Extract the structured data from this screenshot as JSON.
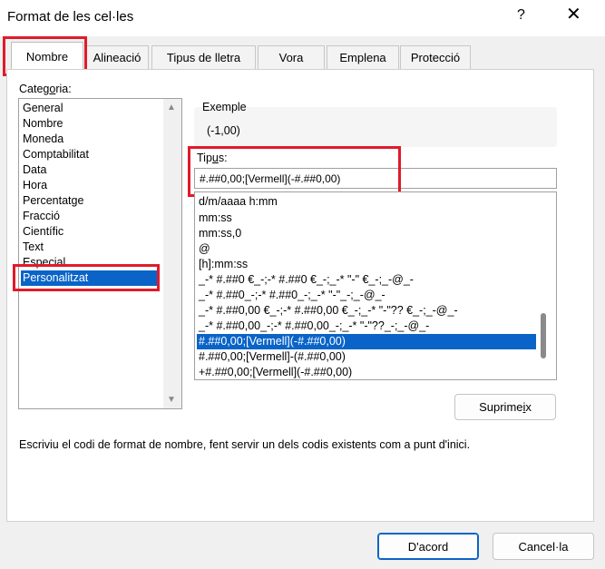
{
  "window": {
    "title": "Format de les cel·les",
    "help": "?",
    "close": "✕"
  },
  "tabs": [
    "Nombre",
    "Alineació",
    "Tipus de lletra",
    "Vora",
    "Emplena",
    "Protecció"
  ],
  "category": {
    "label_pre": "Categ",
    "label_u": "o",
    "label_post": "ria:",
    "items": [
      "General",
      "Nombre",
      "Moneda",
      "Comptabilitat",
      "Data",
      "Hora",
      "Percentatge",
      "Fracció",
      "Científic",
      "Text",
      "Especial",
      "Personalitzat"
    ],
    "selected": "Personalitzat"
  },
  "example": {
    "label": "Exemple",
    "value": "(-1,00)"
  },
  "type": {
    "label_pre": "Tip",
    "label_u": "u",
    "label_post": "s:",
    "value": "#.##0,00;[Vermell](-#.##0,00)",
    "items": [
      "d/m/aaaa h:mm",
      "mm:ss",
      "mm:ss,0",
      "@",
      "[h]:mm:ss",
      "_-* #.##0 €_-;-* #.##0 €_-;_-* \"-\" €_-;_-@_-",
      "_-* #.##0_-;-* #.##0_-;_-* \"-\"_-;_-@_-",
      "_-* #.##0,00 €_-;-* #.##0,00 €_-;_-* \"-\"?? €_-;_-@_-",
      "_-* #.##0,00_-;-* #.##0,00_-;_-* \"-\"??_-;_-@_-",
      "#.##0,00;[Vermell](-#.##0,00)",
      "#.##0,00;[Vermell]-(#.##0,00)",
      "+#.##0,00;[Vermell](-#.##0,00)"
    ],
    "selected": "#.##0,00;[Vermell](-#.##0,00)"
  },
  "delete_button": {
    "pre": "Suprime",
    "u": "i",
    "post": "x"
  },
  "description": "Escriviu el codi de format de nombre, fent servir un dels codis existents com a punt d'inici.",
  "ok_button": "D'acord",
  "cancel_button": "Cancel·la"
}
